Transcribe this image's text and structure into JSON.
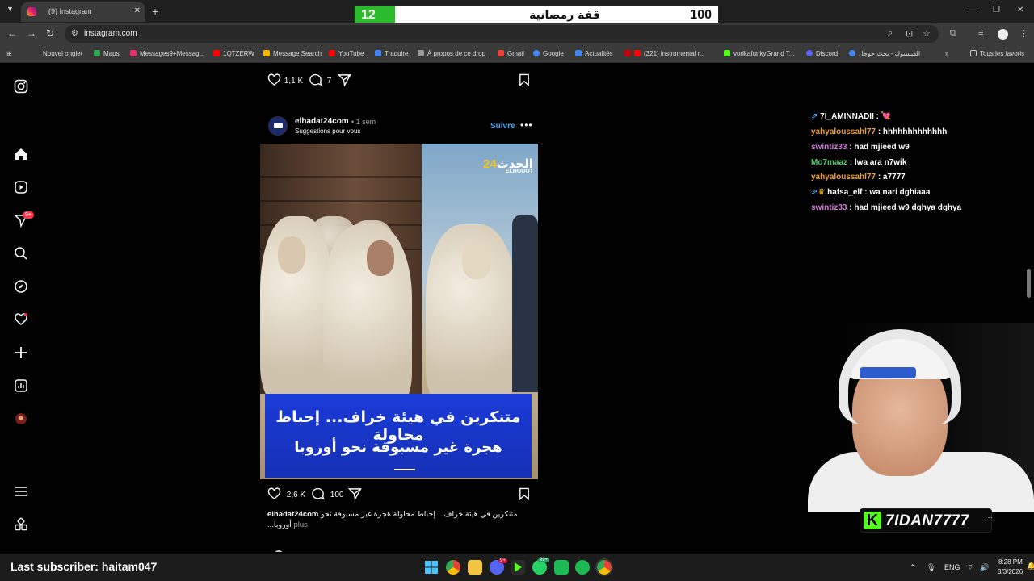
{
  "browser": {
    "tab_title": "(9) Instagram",
    "url": "instagram.com",
    "bookmarks": [
      {
        "label": "Nouvel onglet",
        "color": "#888888"
      },
      {
        "label": "Maps",
        "color": "#34a853"
      },
      {
        "label": "Messages9+Messag...",
        "color": "#e1306c"
      },
      {
        "label": "1QTZERW",
        "color": "#ff0000"
      },
      {
        "label": "Message Search",
        "color": "#f4b400"
      },
      {
        "label": "YouTube",
        "color": "#ff0000"
      },
      {
        "label": "Traduire",
        "color": "#4285f4"
      },
      {
        "label": "À propos de ce drop",
        "color": "#999999"
      },
      {
        "label": "Gmail",
        "color": "#ea4335"
      },
      {
        "label": "Google",
        "color": "#4285f4"
      },
      {
        "label": "Actualités",
        "color": "#4285f4"
      },
      {
        "label": "(321) instrumental r...",
        "color": "#ff0000"
      },
      {
        "label": "vodkafunkyGrand T...",
        "color": "#53fc18"
      },
      {
        "label": "Discord",
        "color": "#5865f2"
      },
      {
        "label": "الفيسبوك - بحث جوجل",
        "color": "#4285f4"
      }
    ],
    "all_bookmarks": "Tous les favoris"
  },
  "overlay": {
    "score_left": "12",
    "score_title": "قفة رمضانية",
    "score_right": "100",
    "last_subscriber": "Last subscriber: haitam047",
    "kick_name": "7IDAN7777",
    "accent_green": "#2cbb2c",
    "kick_green": "#53fc18"
  },
  "sidebar": {
    "notifications_badge": "9+"
  },
  "prev_post": {
    "likes": "1,1 K",
    "comments": "7"
  },
  "post": {
    "username": "elhadat24com",
    "time": "• 1 sem",
    "suggestion": "Suggestions pour vous",
    "follow_label": "Suivre",
    "image_caption_line1": "متنكرين في هيئة خراف... إحباط محاولة",
    "image_caption_line2": "هجرة غير  مسبوقة نحو أوروبا",
    "logo_text": "الحدث",
    "logo_number": "24",
    "logo_sub": "ELHODOT",
    "likes": "2,6 K",
    "comments": "100",
    "caption_user": "elhadat24com",
    "caption_text": "متنكرين في هيئة خراف... إحباط محاولة هجرة غير مسبوقة نحو أوروبا...",
    "caption_more": "plus",
    "follow_color": "#4aa3f5"
  },
  "chat": [
    {
      "user": "7I_AMINNADII",
      "message": " : 💘",
      "color": "#ffffff"
    },
    {
      "user": "yahyaloussahl77",
      "message": " : hhhhhhhhhhhhh",
      "color": "#f0a030"
    },
    {
      "user": "swintiz33",
      "message": " : had mjieed w9",
      "color": "#d07ad8"
    },
    {
      "user": "Mo7maaz",
      "message": " : lwa ara n7wik",
      "color": "#4fc96a"
    },
    {
      "user": "yahyaloussahl77",
      "message": " : a7777",
      "color": "#f0a030"
    },
    {
      "user": "hafsa_elf",
      "message": " : wa nari dghiaaa",
      "color": "#ffffff"
    },
    {
      "user": "swintiz33",
      "message": " : had mjieed w9 dghya dghya",
      "color": "#d07ad8"
    }
  ],
  "taskbar": {
    "lang": "ENG",
    "time": "8:28 PM",
    "date": "3/3/2026",
    "discord_badge": "9+",
    "whatsapp_badge": "99+"
  }
}
